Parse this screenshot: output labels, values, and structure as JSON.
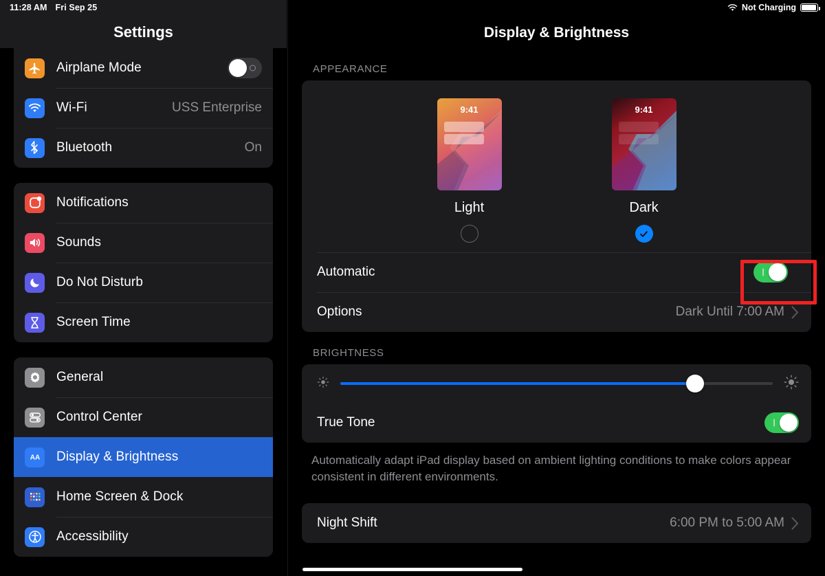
{
  "status_bar": {
    "time": "11:28 AM",
    "date": "Fri Sep 25",
    "battery_text": "Not Charging",
    "wifi_icon": "wifi-icon",
    "battery_icon": "battery-icon"
  },
  "sidebar": {
    "title": "Settings",
    "groups": [
      {
        "items": [
          {
            "label": "Airplane Mode",
            "icon": "airplane-icon",
            "icon_color": "#f0952c",
            "control": "toggle",
            "toggle_state": "off"
          },
          {
            "label": "Wi-Fi",
            "icon": "wifi-icon",
            "icon_color": "#2f7cf6",
            "control": "value",
            "value": "USS Enterprise"
          },
          {
            "label": "Bluetooth",
            "icon": "bluetooth-icon",
            "icon_color": "#2f7cf6",
            "control": "value",
            "value": "On"
          }
        ]
      },
      {
        "items": [
          {
            "label": "Notifications",
            "icon": "notifications-icon",
            "icon_color": "#eb4d3d"
          },
          {
            "label": "Sounds",
            "icon": "speaker-icon",
            "icon_color": "#eb4b63"
          },
          {
            "label": "Do Not Disturb",
            "icon": "moon-icon",
            "icon_color": "#5e5ce6"
          },
          {
            "label": "Screen Time",
            "icon": "hourglass-icon",
            "icon_color": "#5e5ce6"
          }
        ]
      },
      {
        "items": [
          {
            "label": "General",
            "icon": "gear-icon",
            "icon_color": "#8e8e93"
          },
          {
            "label": "Control Center",
            "icon": "sliders-icon",
            "icon_color": "#8e8e93"
          },
          {
            "label": "Display & Brightness",
            "icon": "aa-text-icon",
            "icon_color": "#2f7cf6",
            "selected": true
          },
          {
            "label": "Home Screen & Dock",
            "icon": "home-screen-icon",
            "icon_color": "#2f5fd0"
          },
          {
            "label": "Accessibility",
            "icon": "accessibility-icon",
            "icon_color": "#2f7cf6"
          }
        ]
      }
    ],
    "selected_item": "Display & Brightness",
    "selection_color": "#2563d1"
  },
  "detail": {
    "title": "Display & Brightness",
    "appearance": {
      "section_label": "APPEARANCE",
      "options": [
        {
          "name": "Light",
          "preview_time": "9:41",
          "selected": false
        },
        {
          "name": "Dark",
          "preview_time": "9:41",
          "selected": true
        }
      ],
      "automatic": {
        "label": "Automatic",
        "toggle_state": "on",
        "highlighted": true
      },
      "options_row": {
        "label": "Options",
        "value": "Dark Until 7:00 AM",
        "chevron": "chevron-right-icon"
      }
    },
    "brightness": {
      "section_label": "BRIGHTNESS",
      "slider": {
        "value_percent": 82,
        "min_icon": "brightness-low-icon",
        "max_icon": "brightness-high-icon"
      },
      "true_tone": {
        "label": "True Tone",
        "toggle_state": "on"
      },
      "footnote": "Automatically adapt iPad display based on ambient lighting conditions to make colors appear consistent in different environments."
    },
    "night_shift": {
      "label": "Night Shift",
      "value": "6:00 PM to 5:00 AM",
      "chevron": "chevron-right-icon"
    }
  },
  "colors": {
    "accent_blue": "#0a84ff",
    "toggle_on_green": "#34c759",
    "annotation_red": "#ef2222",
    "card_background": "#1c1c1e",
    "page_background": "#000000",
    "secondary_text": "#8e8e93"
  }
}
